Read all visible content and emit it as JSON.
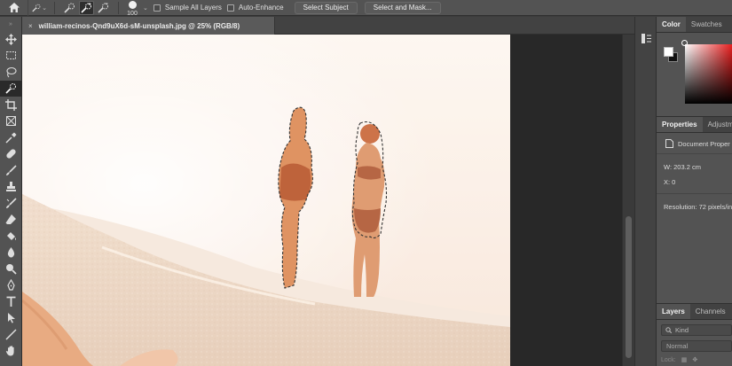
{
  "options_bar": {
    "brush_size": "100",
    "sample_all_layers": "Sample All Layers",
    "auto_enhance": "Auto-Enhance",
    "select_subject": "Select Subject",
    "select_and_mask": "Select and Mask..."
  },
  "document": {
    "tab_title": "william-recinos-Qnd9uX6d-sM-unsplash.jpg @ 25% (RGB/8)",
    "close": "×"
  },
  "color_panel": {
    "tabs": [
      "Color",
      "Swatches"
    ],
    "foreground": "#ffffff",
    "background": "#111111"
  },
  "properties_panel": {
    "tabs": [
      "Properties",
      "Adjustm"
    ],
    "document_label": "Document Proper",
    "width": "W:  203.2 cm",
    "x": "X:  0",
    "resolution": "Resolution: 72 pixels/inc"
  },
  "layers_panel": {
    "tabs": [
      "Layers",
      "Channels"
    ],
    "kind_placeholder": "Kind",
    "blend_mode": "Normal",
    "lock_label": "Lock:"
  },
  "colors": {
    "ui_bg": "#535353",
    "canvas_bg": "#282828",
    "accent": "#ffffff"
  }
}
